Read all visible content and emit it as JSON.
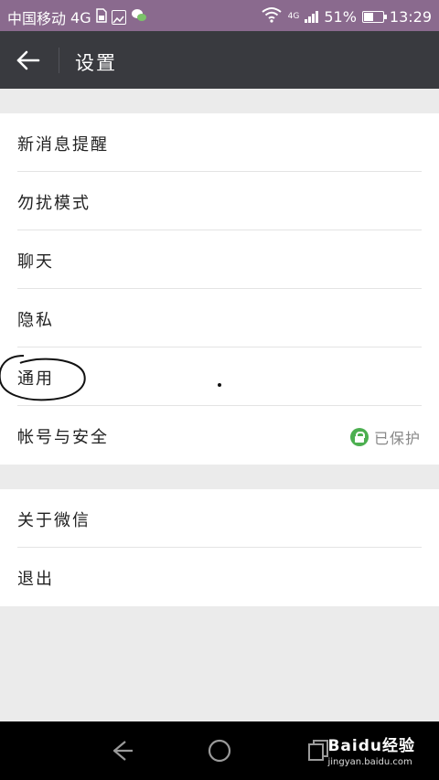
{
  "status_bar": {
    "carrier": "中国移动",
    "network": "4G",
    "network_small": "4G",
    "battery_percent": "51%",
    "battery_level": 0.51,
    "time": "13:29"
  },
  "title_bar": {
    "title": "设置"
  },
  "group1": {
    "items": [
      {
        "label": "新消息提醒"
      },
      {
        "label": "勿扰模式"
      },
      {
        "label": "聊天"
      },
      {
        "label": "隐私"
      },
      {
        "label": "通用"
      },
      {
        "label": "帐号与安全",
        "status": "已保护"
      }
    ]
  },
  "group2": {
    "items": [
      {
        "label": "关于微信"
      },
      {
        "label": "退出"
      }
    ]
  },
  "watermark": {
    "brand": "Baidu经验",
    "url": "jingyan.baidu.com"
  },
  "colors": {
    "status_bar": "#8a6a8e",
    "title_bar": "#393a3f",
    "background": "#ebebeb",
    "protect_green": "#4caf50"
  }
}
